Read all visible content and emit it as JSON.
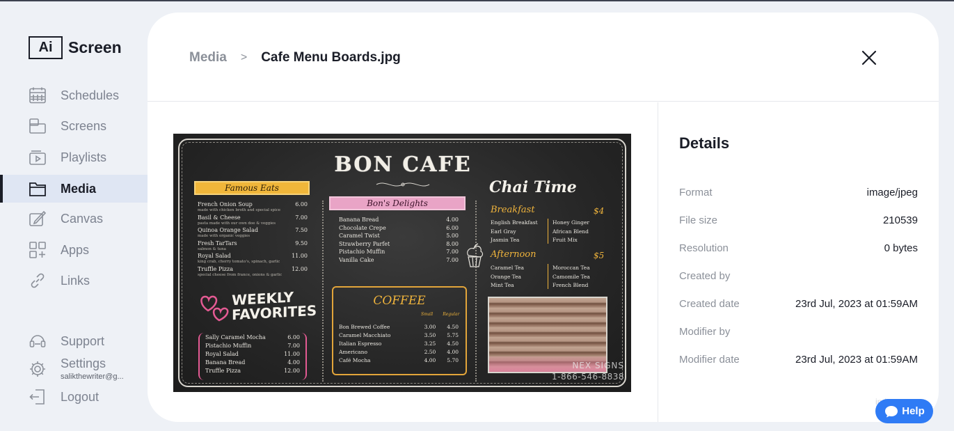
{
  "app": {
    "logo_mark": "Ai",
    "logo_text": "Screen"
  },
  "sidebar": {
    "items": [
      {
        "label": "Schedules",
        "icon": "calendar-icon"
      },
      {
        "label": "Screens",
        "icon": "screens-icon"
      },
      {
        "label": "Playlists",
        "icon": "playlist-icon"
      },
      {
        "label": "Media",
        "icon": "folder-icon",
        "active": true
      },
      {
        "label": "Canvas",
        "icon": "canvas-icon"
      },
      {
        "label": "Apps",
        "icon": "apps-icon"
      },
      {
        "label": "Links",
        "icon": "link-icon"
      }
    ],
    "bottom": {
      "support": "Support",
      "settings": "Settings",
      "settings_email": "salikthewriter@g...",
      "logout": "Logout"
    }
  },
  "header": {
    "breadcrumb_root": "Media",
    "breadcrumb_separator": ">",
    "file_name": "Cafe Menu Boards.jpg"
  },
  "preview": {
    "title": "BON CAFE",
    "famous_eats": {
      "heading": "Famous Eats",
      "items": [
        {
          "name": "French Onion Soup",
          "price": "6.00",
          "note": "made with chicken broth and special spice"
        },
        {
          "name": "Basil & Cheese",
          "price": "7.00",
          "note": "pasta made with our own doe & veggies"
        },
        {
          "name": "Quinoa Orange Salad",
          "price": "7.50",
          "note": "made with organic veggies"
        },
        {
          "name": "Fresh TarTars",
          "price": "9.50",
          "note": "salmon & tuna"
        },
        {
          "name": "Royal Salad",
          "price": "11.00",
          "note": "king crab, cherry tomato's, spinach, garlic"
        },
        {
          "name": "Truffle Pizza",
          "price": "12.00",
          "note": "special cheese from france, onions & garlic"
        }
      ]
    },
    "bons_delights": {
      "heading": "Bon's Delights",
      "items": [
        {
          "name": "Banana Bread",
          "price": "4.00"
        },
        {
          "name": "Chocolate Crepe",
          "price": "6.00"
        },
        {
          "name": "Caramel Twist",
          "price": "5.00"
        },
        {
          "name": "Strawberry Parfet",
          "price": "8.00"
        },
        {
          "name": "Pistachio Muffin",
          "price": "7.00"
        },
        {
          "name": "Vanilla Cake",
          "price": "7.00"
        }
      ]
    },
    "weekly": {
      "line1": "WEEKLY",
      "line2": "FAVORITES",
      "items": [
        {
          "name": "Sally Caramel Mocha",
          "price": "6.00"
        },
        {
          "name": "Pistachio Muffin",
          "price": "7.00"
        },
        {
          "name": "Royal Salad",
          "price": "11.00"
        },
        {
          "name": "Banana Bread",
          "price": "4.00"
        },
        {
          "name": "Truffle Pizza",
          "price": "12.00"
        }
      ]
    },
    "coffee": {
      "heading": "COFFEE",
      "col_small": "Small",
      "col_regular": "Regular",
      "items": [
        {
          "name": "Bon Brewed Coffee",
          "small": "3.00",
          "regular": "4.50"
        },
        {
          "name": "Caramel Macchiato",
          "small": "3.50",
          "regular": "5.75"
        },
        {
          "name": "Italian Espresso",
          "small": "3.25",
          "regular": "4.50"
        },
        {
          "name": "Americano",
          "small": "2.50",
          "regular": "4.00"
        },
        {
          "name": "Café Mocha",
          "small": "4.00",
          "regular": "5.70"
        }
      ]
    },
    "chai": {
      "heading": "Chai Time",
      "breakfast": {
        "title": "Breakfast",
        "price": "$4",
        "left": [
          "English Breakfast",
          "Earl Gray",
          "Jasmin Tea"
        ],
        "right": [
          "Honey Ginger",
          "African Blend",
          "Fruit Mix"
        ]
      },
      "afternoon": {
        "title": "Afternoon",
        "price": "$5",
        "left": [
          "Caramel Tea",
          "Orange Tea",
          "Mint Tea"
        ],
        "right": [
          "Moroccan Tea",
          "Camomile Tea",
          "French Blend"
        ]
      }
    },
    "watermark_brand": "NEX SIGNS",
    "watermark_phone": "1-866-546-8838"
  },
  "details": {
    "title": "Details",
    "rows": [
      {
        "label": "Format",
        "value": "image/jpeg"
      },
      {
        "label": "File size",
        "value": "210539"
      },
      {
        "label": "Resolution",
        "value": "0 bytes"
      },
      {
        "label": "Created by",
        "value": ""
      },
      {
        "label": "Created date",
        "value": "23rd Jul, 2023 at 01:59AM"
      },
      {
        "label": "Modifier by",
        "value": ""
      },
      {
        "label": "Modifier date",
        "value": "23rd Jul, 2023 at 01:59AM"
      }
    ]
  },
  "help": {
    "label": "Help",
    "background_text": "indows."
  },
  "colors": {
    "accent": "#2f7bf5",
    "active_nav_bg": "#dfe6f3",
    "page_bg": "#eef1f6",
    "chalk_orange": "#f0b43c",
    "chalk_pink": "#e45a93"
  }
}
